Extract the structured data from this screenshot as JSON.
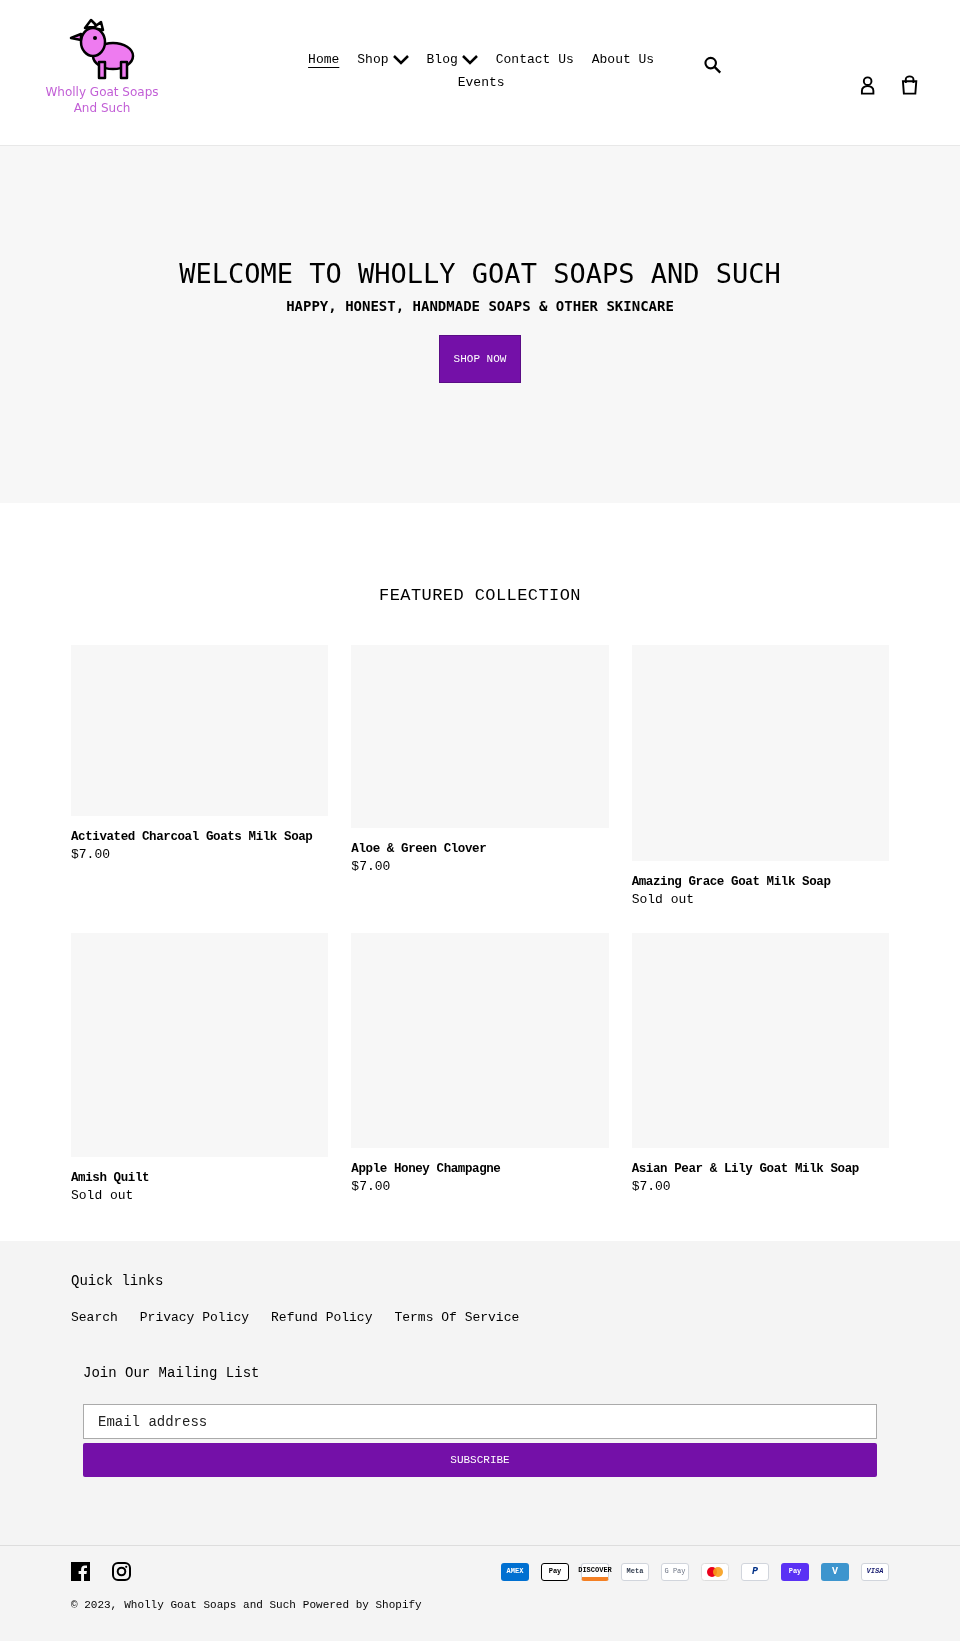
{
  "header": {
    "logo_text": "Wholly Goat Soaps And Such",
    "nav": [
      {
        "label": "Home",
        "selected": true,
        "dropdown": false
      },
      {
        "label": "Shop",
        "selected": false,
        "dropdown": true
      },
      {
        "label": "Blog",
        "selected": false,
        "dropdown": true
      },
      {
        "label": "Contact Us",
        "selected": false,
        "dropdown": false
      },
      {
        "label": "About Us",
        "selected": false,
        "dropdown": false
      },
      {
        "label": "Events",
        "selected": false,
        "dropdown": false
      }
    ]
  },
  "hero": {
    "title": "WELCOME TO WHOLLY GOAT SOAPS AND SUCH",
    "subtitle": "HAPPY, HONEST, HANDMADE SOAPS & OTHER SKINCARE",
    "button": "SHOP NOW"
  },
  "featured": {
    "title": "FEATURED COLLECTION",
    "products": [
      {
        "name": "Activated Charcoal Goats Milk Soap",
        "price": "$7.00"
      },
      {
        "name": "Aloe & Green Clover",
        "price": "$7.00"
      },
      {
        "name": "Amazing Grace Goat Milk Soap",
        "price": "Sold out"
      },
      {
        "name": "Amish Quilt",
        "price": "Sold out"
      },
      {
        "name": "Apple Honey Champagne",
        "price": "$7.00"
      },
      {
        "name": "Asian Pear & Lily Goat Milk Soap",
        "price": "$7.00"
      }
    ]
  },
  "footer": {
    "quick_links_title": "Quick links",
    "links": [
      "Search",
      "Privacy Policy",
      "Refund Policy",
      "Terms Of Service"
    ],
    "mailing_title": "Join Our Mailing List",
    "email_placeholder": "Email address",
    "subscribe": "SUBSCRIBE",
    "payments": [
      {
        "kind": "amex",
        "label": "AMEX"
      },
      {
        "kind": "applepay",
        "label": "Pay"
      },
      {
        "kind": "discover",
        "label": "DISCOVER"
      },
      {
        "kind": "meta",
        "label": "Meta"
      },
      {
        "kind": "gpay",
        "label": "G Pay"
      },
      {
        "kind": "mastercard"
      },
      {
        "kind": "paypal",
        "label": "P"
      },
      {
        "kind": "shoppay",
        "label": "Pay"
      },
      {
        "kind": "venmo",
        "label": "V"
      },
      {
        "kind": "visa",
        "label": "VISA"
      }
    ],
    "copyright": "© 2023,",
    "store_link": "Wholly Goat Soaps and Such",
    "powered": "Powered by Shopify"
  }
}
